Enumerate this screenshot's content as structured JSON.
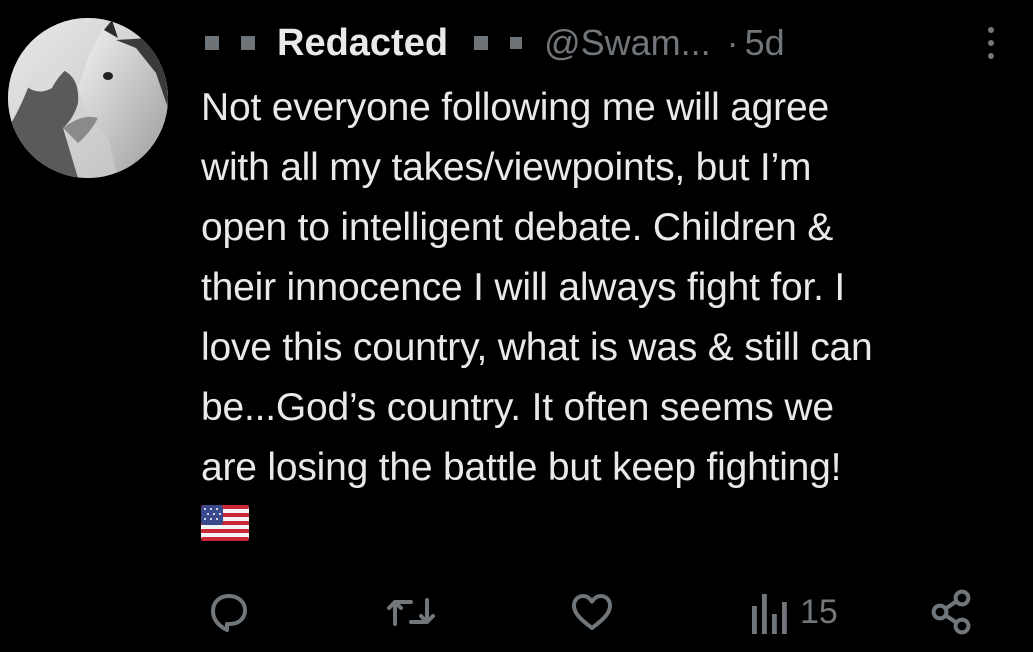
{
  "tweet": {
    "author": {
      "display_name": "Redacted",
      "handle": "@Swam...",
      "avatar_icon": "avatar-woman-with-horse"
    },
    "separator": "·",
    "time": "5d",
    "text": "Not everyone following me will agree\nwith all my takes/viewpoints, but I’m\nopen to intelligent debate. Children &\ntheir innocence I will always fight for. I\nlove this country, what is was & still can\nbe...God’s country. It often seems we\nare losing the battle but keep fighting!",
    "emoji": "us-flag-icon"
  },
  "actions": {
    "reply_icon": "reply-icon",
    "retweet_icon": "retweet-icon",
    "like_icon": "heart-icon",
    "views_icon": "views-icon",
    "views_count": "15",
    "share_icon": "share-icon"
  },
  "colors": {
    "background": "#000000",
    "text": "#e7e9ea",
    "muted": "#71767b",
    "redaction": "#6e7378"
  }
}
